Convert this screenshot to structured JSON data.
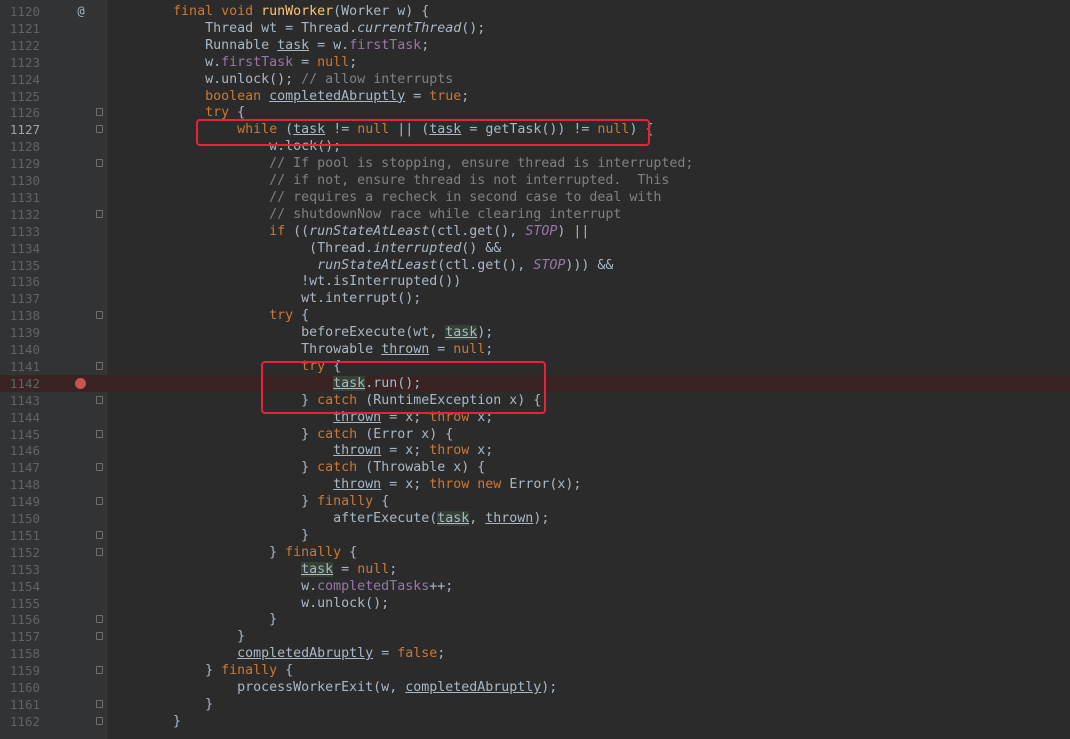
{
  "editor": {
    "lines": [
      {
        "n": "1120",
        "m": "@",
        "fold": false,
        "t": [
          [
            "        ",
            ""
          ],
          [
            "final void ",
            "k"
          ],
          [
            "runWorker",
            "f"
          ],
          [
            "(Worker w) {",
            ""
          ]
        ]
      },
      {
        "n": "1121",
        "fold": false,
        "t": [
          [
            "            Thread wt = Thread.",
            ""
          ],
          [
            "currentThread",
            "i"
          ],
          [
            "();",
            ""
          ]
        ]
      },
      {
        "n": "1122",
        "fold": false,
        "t": [
          [
            "            Runnable ",
            ""
          ],
          [
            "task",
            "u"
          ],
          [
            " = w.",
            ""
          ],
          [
            "firstTask",
            "fd"
          ],
          [
            ";",
            ""
          ]
        ]
      },
      {
        "n": "1123",
        "fold": false,
        "t": [
          [
            "            w.",
            ""
          ],
          [
            "firstTask",
            "fd"
          ],
          [
            " = ",
            ""
          ],
          [
            "null",
            "k"
          ],
          [
            ";",
            ""
          ]
        ]
      },
      {
        "n": "1124",
        "fold": false,
        "t": [
          [
            "            w.unlock(); ",
            ""
          ],
          [
            "// allow interrupts",
            "c"
          ]
        ]
      },
      {
        "n": "1125",
        "fold": false,
        "t": [
          [
            "            ",
            ""
          ],
          [
            "boolean ",
            "k"
          ],
          [
            "completedAbruptly",
            "u"
          ],
          [
            " = ",
            ""
          ],
          [
            "true",
            "k"
          ],
          [
            ";",
            ""
          ]
        ]
      },
      {
        "n": "1126",
        "fold": true,
        "t": [
          [
            "            ",
            ""
          ],
          [
            "try ",
            "k"
          ],
          [
            "{",
            ""
          ]
        ]
      },
      {
        "n": "1127",
        "fold": true,
        "cur": true,
        "t": [
          [
            "                ",
            ""
          ],
          [
            "while ",
            "k"
          ],
          [
            "(",
            ""
          ],
          [
            "task",
            "u"
          ],
          [
            " != ",
            ""
          ],
          [
            "null ",
            "k"
          ],
          [
            "|| (",
            ""
          ],
          [
            "task",
            "u"
          ],
          [
            " = getTask()) != ",
            ""
          ],
          [
            "null",
            "k"
          ],
          [
            ") {",
            ""
          ]
        ]
      },
      {
        "n": "1128",
        "fold": false,
        "t": [
          [
            "                    w.lock();",
            ""
          ]
        ]
      },
      {
        "n": "1129",
        "fold": true,
        "t": [
          [
            "                    ",
            ""
          ],
          [
            "// If pool is stopping, ensure thread is interrupted;",
            "c"
          ]
        ]
      },
      {
        "n": "1130",
        "fold": false,
        "t": [
          [
            "                    ",
            ""
          ],
          [
            "// if not, ensure thread is not interrupted.  This",
            "c"
          ]
        ]
      },
      {
        "n": "1131",
        "fold": false,
        "t": [
          [
            "                    ",
            ""
          ],
          [
            "// requires a recheck in second case to deal with",
            "c"
          ]
        ]
      },
      {
        "n": "1132",
        "fold": true,
        "t": [
          [
            "                    ",
            ""
          ],
          [
            "// shutdownNow race while clearing interrupt",
            "c"
          ]
        ]
      },
      {
        "n": "1133",
        "fold": false,
        "t": [
          [
            "                    ",
            ""
          ],
          [
            "if ",
            "k"
          ],
          [
            "((",
            ""
          ],
          [
            "runStateAtLeast",
            "i"
          ],
          [
            "(ctl.get(), ",
            ""
          ],
          [
            "STOP",
            "fd i"
          ],
          [
            ") ||",
            ""
          ]
        ]
      },
      {
        "n": "1134",
        "fold": false,
        "t": [
          [
            "                         (Thread.",
            ""
          ],
          [
            "interrupted",
            "i"
          ],
          [
            "() &&",
            ""
          ]
        ]
      },
      {
        "n": "1135",
        "fold": false,
        "t": [
          [
            "                          ",
            ""
          ],
          [
            "runStateAtLeast",
            "i"
          ],
          [
            "(ctl.get(), ",
            ""
          ],
          [
            "STOP",
            "fd i"
          ],
          [
            "))) &&",
            ""
          ]
        ]
      },
      {
        "n": "1136",
        "fold": false,
        "t": [
          [
            "                        !wt.isInterrupted())",
            ""
          ]
        ]
      },
      {
        "n": "1137",
        "fold": false,
        "t": [
          [
            "                        wt.interrupt();",
            ""
          ]
        ]
      },
      {
        "n": "1138",
        "fold": true,
        "t": [
          [
            "                    ",
            ""
          ],
          [
            "try ",
            "k"
          ],
          [
            "{",
            ""
          ]
        ]
      },
      {
        "n": "1139",
        "fold": false,
        "t": [
          [
            "                        beforeExecute(wt, ",
            ""
          ],
          [
            "task",
            "u hl"
          ],
          [
            ");",
            ""
          ]
        ]
      },
      {
        "n": "1140",
        "fold": false,
        "t": [
          [
            "                        Throwable ",
            ""
          ],
          [
            "thrown",
            "u"
          ],
          [
            " = ",
            ""
          ],
          [
            "null",
            "k"
          ],
          [
            ";",
            ""
          ]
        ]
      },
      {
        "n": "1141",
        "fold": true,
        "t": [
          [
            "                        ",
            ""
          ],
          [
            "try ",
            "k"
          ],
          [
            "{",
            ""
          ]
        ]
      },
      {
        "n": "1142",
        "fold": false,
        "bp": true,
        "t": [
          [
            "                            ",
            ""
          ],
          [
            "task",
            "u hl"
          ],
          [
            ".run();",
            ""
          ]
        ]
      },
      {
        "n": "1143",
        "fold": true,
        "t": [
          [
            "                        } ",
            ""
          ],
          [
            "catch ",
            "k"
          ],
          [
            "(RuntimeException x) {",
            ""
          ]
        ]
      },
      {
        "n": "1144",
        "fold": false,
        "t": [
          [
            "                            ",
            ""
          ],
          [
            "thrown",
            "u"
          ],
          [
            " = x; ",
            ""
          ],
          [
            "throw ",
            "k"
          ],
          [
            "x;",
            ""
          ]
        ]
      },
      {
        "n": "1145",
        "fold": true,
        "t": [
          [
            "                        } ",
            ""
          ],
          [
            "catch ",
            "k"
          ],
          [
            "(Error x) {",
            ""
          ]
        ]
      },
      {
        "n": "1146",
        "fold": false,
        "t": [
          [
            "                            ",
            ""
          ],
          [
            "thrown",
            "u"
          ],
          [
            " = x; ",
            ""
          ],
          [
            "throw ",
            "k"
          ],
          [
            "x;",
            ""
          ]
        ]
      },
      {
        "n": "1147",
        "fold": true,
        "t": [
          [
            "                        } ",
            ""
          ],
          [
            "catch ",
            "k"
          ],
          [
            "(Throwable x) {",
            ""
          ]
        ]
      },
      {
        "n": "1148",
        "fold": false,
        "t": [
          [
            "                            ",
            ""
          ],
          [
            "thrown",
            "u"
          ],
          [
            " = x; ",
            ""
          ],
          [
            "throw new ",
            "k"
          ],
          [
            "Error(x);",
            ""
          ]
        ]
      },
      {
        "n": "1149",
        "fold": true,
        "t": [
          [
            "                        } ",
            ""
          ],
          [
            "finally ",
            "k"
          ],
          [
            "{",
            ""
          ]
        ]
      },
      {
        "n": "1150",
        "fold": false,
        "t": [
          [
            "                            afterExecute(",
            ""
          ],
          [
            "task",
            "u hl"
          ],
          [
            ", ",
            ""
          ],
          [
            "thrown",
            "u"
          ],
          [
            ");",
            ""
          ]
        ]
      },
      {
        "n": "1151",
        "fold": true,
        "t": [
          [
            "                        }",
            ""
          ]
        ]
      },
      {
        "n": "1152",
        "fold": true,
        "t": [
          [
            "                    } ",
            ""
          ],
          [
            "finally ",
            "k"
          ],
          [
            "{",
            ""
          ]
        ]
      },
      {
        "n": "1153",
        "fold": false,
        "t": [
          [
            "                        ",
            ""
          ],
          [
            "task",
            "u hl"
          ],
          [
            " = ",
            ""
          ],
          [
            "null",
            "k"
          ],
          [
            ";",
            ""
          ]
        ]
      },
      {
        "n": "1154",
        "fold": false,
        "t": [
          [
            "                        w.",
            ""
          ],
          [
            "completedTasks",
            "fd"
          ],
          [
            "++;",
            ""
          ]
        ]
      },
      {
        "n": "1155",
        "fold": false,
        "t": [
          [
            "                        w.unlock();",
            ""
          ]
        ]
      },
      {
        "n": "1156",
        "fold": true,
        "t": [
          [
            "                    }",
            ""
          ]
        ]
      },
      {
        "n": "1157",
        "fold": true,
        "t": [
          [
            "                }",
            ""
          ]
        ]
      },
      {
        "n": "1158",
        "fold": false,
        "t": [
          [
            "                ",
            ""
          ],
          [
            "completedAbruptly",
            "u"
          ],
          [
            " = ",
            ""
          ],
          [
            "false",
            "k"
          ],
          [
            ";",
            ""
          ]
        ]
      },
      {
        "n": "1159",
        "fold": true,
        "t": [
          [
            "            } ",
            ""
          ],
          [
            "finally ",
            "k"
          ],
          [
            "{",
            ""
          ]
        ]
      },
      {
        "n": "1160",
        "fold": false,
        "t": [
          [
            "                processWorkerExit(w, ",
            ""
          ],
          [
            "completedAbruptly",
            "u"
          ],
          [
            ");",
            ""
          ]
        ]
      },
      {
        "n": "1161",
        "fold": true,
        "t": [
          [
            "            }",
            ""
          ]
        ]
      },
      {
        "n": "1162",
        "fold": true,
        "t": [
          [
            "        }",
            ""
          ]
        ]
      }
    ]
  }
}
